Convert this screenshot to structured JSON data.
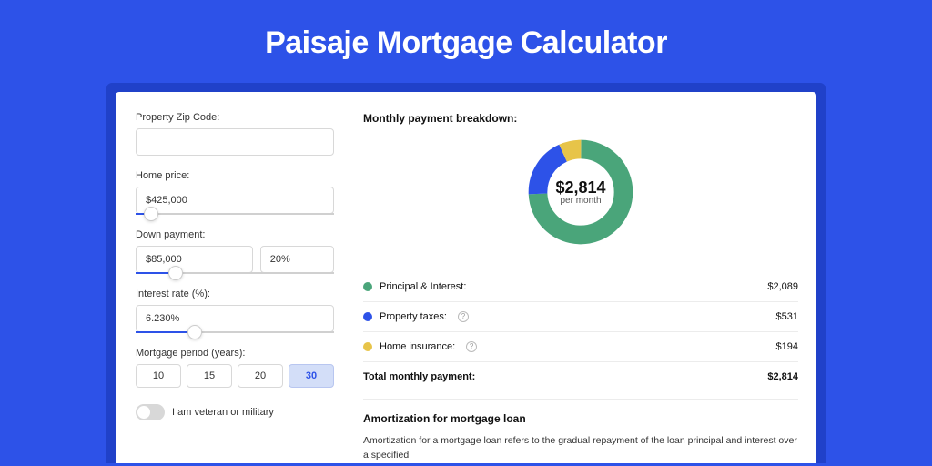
{
  "title": "Paisaje Mortgage Calculator",
  "form": {
    "zip_label": "Property Zip Code:",
    "zip_value": "",
    "home_price_label": "Home price:",
    "home_price_value": "$425,000",
    "home_price_slider_pct": 8,
    "down_payment_label": "Down payment:",
    "down_payment_value": "$85,000",
    "down_payment_pct_value": "20%",
    "down_payment_slider_pct": 20,
    "interest_rate_label": "Interest rate (%):",
    "interest_rate_value": "6.230%",
    "interest_rate_slider_pct": 30,
    "mortgage_period_label": "Mortgage period (years):",
    "period_options": [
      {
        "label": "10",
        "active": false
      },
      {
        "label": "15",
        "active": false
      },
      {
        "label": "20",
        "active": false
      },
      {
        "label": "30",
        "active": true
      }
    ],
    "veteran_label": "I am veteran or military",
    "veteran_on": false
  },
  "breakdown": {
    "heading": "Monthly payment breakdown:",
    "total": "$2,814",
    "per_month": "per month",
    "items": [
      {
        "label": "Principal & Interest:",
        "value": "$2,089",
        "color": "green",
        "info": false
      },
      {
        "label": "Property taxes:",
        "value": "$531",
        "color": "blue",
        "info": true
      },
      {
        "label": "Home insurance:",
        "value": "$194",
        "color": "yellow",
        "info": true
      }
    ],
    "total_label": "Total monthly payment:",
    "total_value": "$2,814"
  },
  "amortization": {
    "title": "Amortization for mortgage loan",
    "text": "Amortization for a mortgage loan refers to the gradual repayment of the loan principal and interest over a specified"
  },
  "chart_data": {
    "type": "pie",
    "title": "Monthly payment breakdown",
    "total": 2814,
    "unit": "$ per month",
    "series": [
      {
        "name": "Principal & Interest",
        "value": 2089,
        "color": "#4aa57a"
      },
      {
        "name": "Property taxes",
        "value": 531,
        "color": "#2d52e8"
      },
      {
        "name": "Home insurance",
        "value": 194,
        "color": "#e7c449"
      }
    ]
  }
}
